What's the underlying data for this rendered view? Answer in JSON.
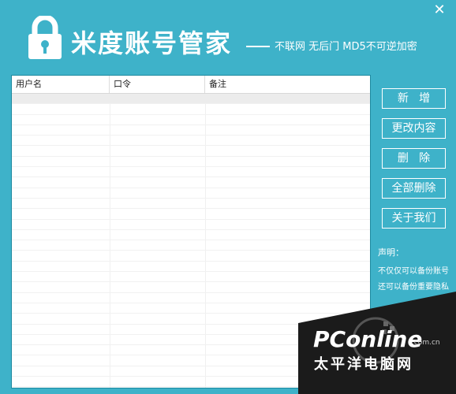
{
  "window": {
    "close_glyph": "✕"
  },
  "header": {
    "title": "米度账号管家",
    "tagline": "不联网  无后门  MD5不可逆加密"
  },
  "table": {
    "columns": [
      "用户名",
      "口令",
      "备注"
    ],
    "rows": []
  },
  "buttons": {
    "add": "新   增",
    "edit": "更改内容",
    "delete": "删   除",
    "delete_all": "全部删除",
    "about": "关于我们"
  },
  "notice": {
    "title": "声明：",
    "line1": "不仅仅可以备份账号",
    "line2": "还可以备份重要隐私"
  },
  "watermark": {
    "brand": "PConline",
    "domain": ".com.cn",
    "subtitle": "太平洋电脑网"
  },
  "icons": {
    "logo": "lock-icon",
    "close": "close-icon"
  }
}
